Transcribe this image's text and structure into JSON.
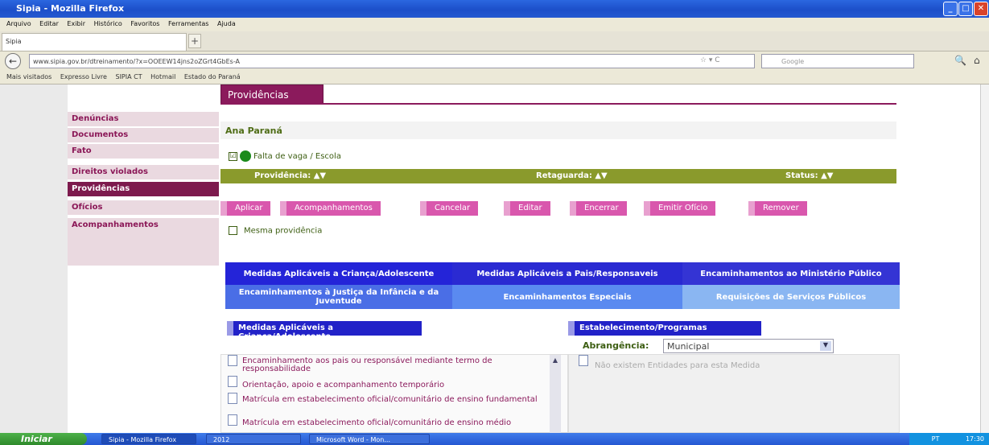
{
  "window": {
    "title": "Sipia - Mozilla Firefox",
    "min": "_",
    "max": "□",
    "close": "✕"
  },
  "menu": [
    "Arquivo",
    "Editar",
    "Exibir",
    "Histórico",
    "Favoritos",
    "Ferramentas",
    "Ajuda"
  ],
  "tab": {
    "label": "Sipia",
    "new_tab": "+"
  },
  "nav": {
    "url": "www.sipia.gov.br/dtreinamento/?x=OOEEW14jns2oZGrt4GbEs-A",
    "search_placeholder": "Google",
    "back": "←",
    "search_go": "🔍",
    "home": "⌂",
    "star": "☆ ▾ C"
  },
  "bookmarks": [
    "Mais visitados",
    "Expresso Livre",
    "SIPIA CT",
    "Hotmail",
    "Estado do Paraná"
  ],
  "sidebar": {
    "items": [
      {
        "label": "Denúncias"
      },
      {
        "label": "Documentos"
      },
      {
        "label": "Fato"
      },
      {
        "label": "Direitos violados"
      },
      {
        "label": "Providências",
        "active": true
      },
      {
        "label": "Ofícios"
      },
      {
        "label": "Acompanhamentos"
      }
    ]
  },
  "main": {
    "section_title": "Providências",
    "person": "Ana Paraná",
    "falta": "Falta de vaga / Escola",
    "falta_check": "☑",
    "columns": {
      "providencia": "Providência: ▲▼",
      "retaguarda": "Retaguarda: ▲▼",
      "status": "Status: ▲▼"
    },
    "actions": [
      "Aplicar",
      "Acompanhamentos",
      "Cancelar",
      "Editar",
      "Encerrar",
      "Emitir Ofício",
      "Remover"
    ],
    "mesma": "Mesma providência",
    "blue_tabs_row1": [
      "Medidas Aplicáveis a Criança/Adolescente",
      "Medidas Aplicáveis a Pais/Responsaveis",
      "Encaminhamentos ao Ministério Público"
    ],
    "blue_tabs_row2": [
      "Encaminhamentos à Justiça da Infância e da Juventude",
      "Encaminhamentos Especiais",
      "Requisições de Serviços Públicos"
    ],
    "left_section": "Medidas Aplicáveis a Criança/Adolescente",
    "right_section": "Estabelecimento/Programas",
    "abrangencia_label": "Abrangência:",
    "abrangencia_value": "Municipal",
    "list": [
      "Encaminhamento aos pais ou responsável mediante termo de responsabilidade",
      "Orientação, apoio e acompanhamento temporário",
      "Matrícula em estabelecimento oficial/comunitário de ensino fundamental",
      "Matrícula em estabelecimento oficial/comunitário de ensino médio"
    ],
    "no_entities": "Não existem Entidades para esta Medida",
    "scroll_up": "▲"
  },
  "taskbar": {
    "start": "Iniciar",
    "tasks": [
      "Sipia - Mozilla Firefox",
      "2012",
      "Microsoft Word - Mon..."
    ],
    "lang": "PT",
    "time": "17:30"
  }
}
